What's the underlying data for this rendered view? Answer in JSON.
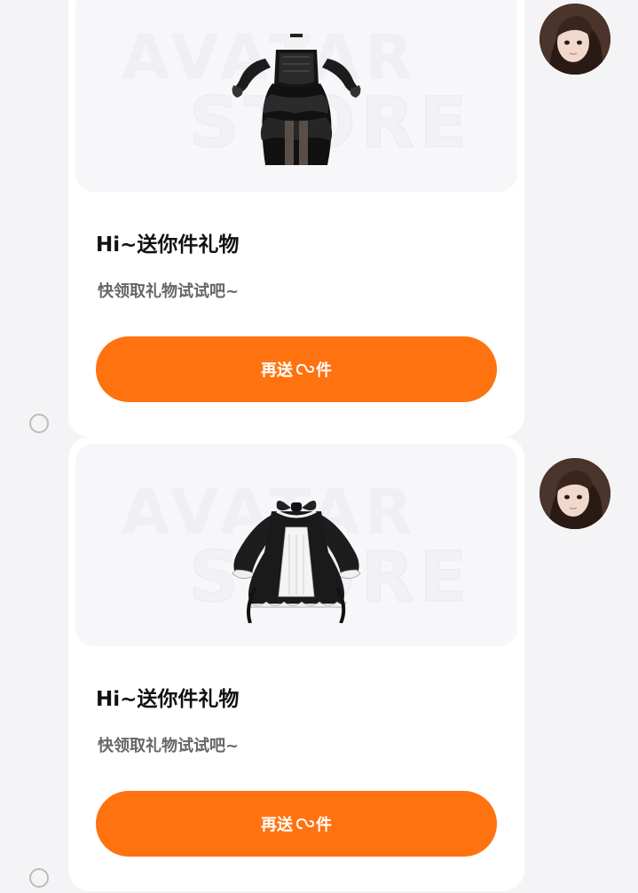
{
  "messages": [
    {
      "title": "Hi~送你件礼物",
      "subtitle": "快领取礼物试试吧~",
      "button": {
        "prefix": "再送",
        "suffix": "件",
        "icon": "gift-link-icon"
      },
      "watermark": {
        "line1": "AVATAR",
        "line2": "STORE"
      },
      "image": "black-gothic-ruffle-dress"
    },
    {
      "title": "Hi~送你件礼物",
      "subtitle": "快领取礼物试试吧~",
      "button": {
        "prefix": "再送",
        "suffix": "件",
        "icon": "gift-link-icon"
      },
      "watermark": {
        "line1": "AVATAR",
        "line2": "STORE"
      },
      "image": "black-lolita-dress-with-bow"
    }
  ],
  "colors": {
    "accent": "#ff7210",
    "background": "#f4f4f6",
    "card": "#ffffff"
  }
}
